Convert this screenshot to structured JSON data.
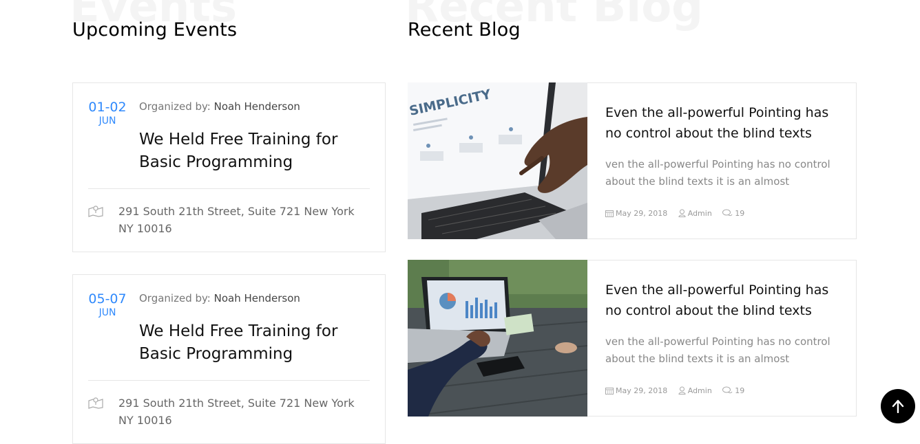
{
  "events_section": {
    "bg_word": "Events",
    "title": "Upcoming Events",
    "items": [
      {
        "day": "01-02",
        "month": "JUN",
        "organized_label": "Organized by:",
        "organizer": "Noah Henderson",
        "title": "We Held Free Training for Basic Programming",
        "address": "291 South 21th Street, Suite 721 New York NY 10016"
      },
      {
        "day": "05-07",
        "month": "JUN",
        "organized_label": "Organized by:",
        "organizer": "Noah Henderson",
        "title": "We Held Free Training for Basic Programming",
        "address": "291 South 21th Street, Suite 721 New York NY 10016"
      }
    ]
  },
  "blog_section": {
    "bg_word": "Recent Blog",
    "title": "Recent Blog",
    "posts": [
      {
        "title": "Even the all-powerful Pointing has no control about the blind texts",
        "excerpt": "ven the all-powerful Pointing has no control about the blind texts it is an almost",
        "date": "May 29, 2018",
        "author": "Admin",
        "comments": "19",
        "screen_text": "SIMPLICITY"
      },
      {
        "title": "Even the all-powerful Pointing has no control about the blind texts",
        "excerpt": "ven the all-powerful Pointing has no control about the blind texts it is an almost",
        "date": "May 29, 2018",
        "author": "Admin",
        "comments": "19"
      }
    ]
  },
  "colors": {
    "accent": "#2f89fc",
    "text_dark": "#111111",
    "text_muted": "#888888",
    "border": "#e6e6e6",
    "bg_word": "#f4f4f4"
  },
  "icons": {
    "location": "map-pin-icon",
    "date": "calendar-icon",
    "author": "user-icon",
    "comments": "chat-icon",
    "scroll_top": "arrow-up-icon"
  }
}
